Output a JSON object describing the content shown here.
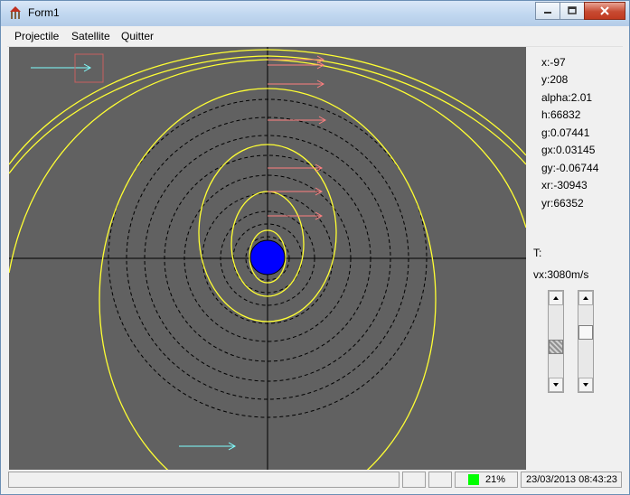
{
  "window": {
    "title": "Form1"
  },
  "menu": {
    "items": [
      "Projectile",
      "Satellite",
      "Quitter"
    ]
  },
  "readouts": {
    "x": "x:-97",
    "y": "y:208",
    "alpha": "alpha:2.01",
    "h": "h:66832",
    "g": "g:0.07441",
    "gx": "gx:0.03145",
    "gy": "gy:-0.06744",
    "xr": "xr:-30943",
    "yr": "yr:66352",
    "T": "T:",
    "vx": "vx:3080m/s"
  },
  "sliders": {
    "left_level": 0.6,
    "right_level": 0.35
  },
  "status": {
    "progress_text": "21%",
    "progress_value": 0.21,
    "datetime": "23/03/2013 08:43:23"
  },
  "colors": {
    "canvas_bg": "#616161",
    "orbit": "#ffff33",
    "planet": "#0000ff",
    "velocity_arrow": "#ff8080",
    "probe_arrow": "#80ffff",
    "progress": "#00ff00"
  },
  "icons": {
    "app": "tower-icon",
    "minimize": "minimize-icon",
    "maximize": "maximize-icon",
    "close": "close-icon"
  }
}
